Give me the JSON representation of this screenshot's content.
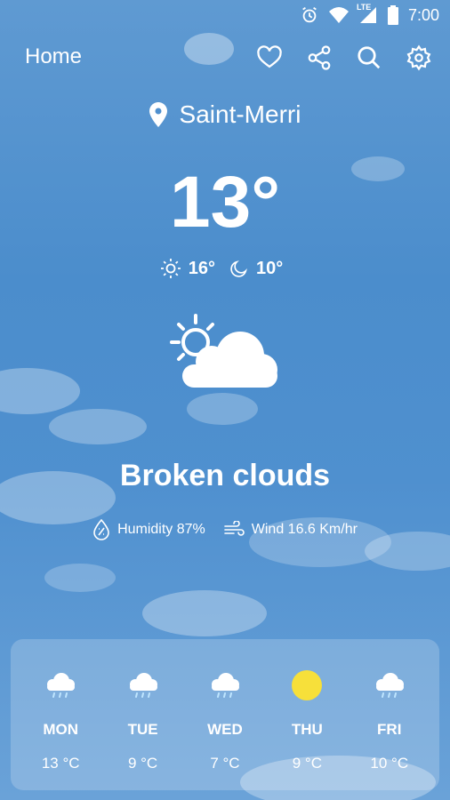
{
  "status_bar": {
    "time": "7:00",
    "network": "LTE",
    "icons": [
      "alarm-icon",
      "wifi-icon",
      "signal-icon",
      "battery-icon"
    ]
  },
  "header": {
    "title": "Home",
    "actions": [
      "heart-icon",
      "share-icon",
      "search-icon",
      "gear-icon"
    ]
  },
  "location": {
    "name": "Saint-Merri",
    "icon": "location-pin-icon"
  },
  "current": {
    "temperature": "13°",
    "high": "16°",
    "low": "10°",
    "condition": "Broken clouds",
    "humidity": "Humidity 87%",
    "wind": "Wind 16.6 Km/hr",
    "icon": "partly-cloudy-icon"
  },
  "forecast": [
    {
      "day": "MON",
      "temp": "13 °C",
      "icon": "rain-cloud-icon"
    },
    {
      "day": "TUE",
      "temp": "9 °C",
      "icon": "rain-cloud-icon"
    },
    {
      "day": "WED",
      "temp": "7 °C",
      "icon": "rain-cloud-icon"
    },
    {
      "day": "THU",
      "temp": "9 °C",
      "icon": "sun-icon"
    },
    {
      "day": "FRI",
      "temp": "10 °C",
      "icon": "rain-cloud-icon"
    }
  ],
  "colors": {
    "sun": "#F7E03A",
    "sky": "#4B8DCC"
  }
}
